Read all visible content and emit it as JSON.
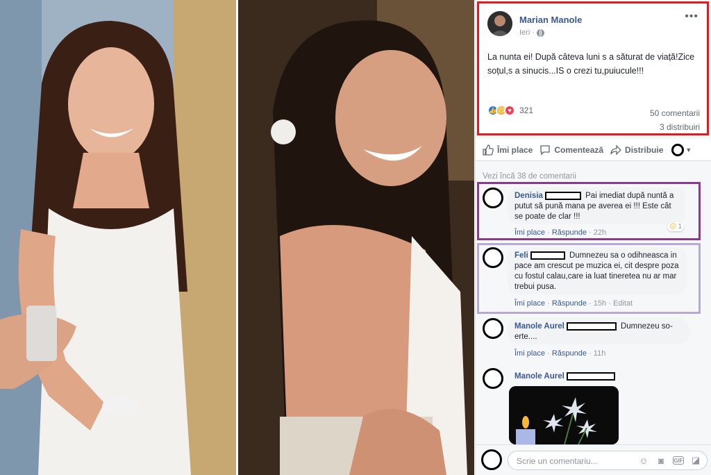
{
  "post": {
    "author": "Marian Manole",
    "time": "Ieri",
    "text": "La nunta ei! După câteva luni s a săturat de viață!Zice soțul,s a sinucis...IS o crezi tu,puiucule!!!",
    "reaction_count": "321",
    "comments_count": "50 comentarii",
    "shares_count": "3 distribuiri"
  },
  "actions": {
    "like": "Îmi place",
    "comment": "Comentează",
    "share": "Distribuie"
  },
  "view_more": "Vezi încă 38 de comentarii",
  "comments": [
    {
      "name": "Denisia",
      "text": "Pai imediat după nuntă a putut să pună mana pe averea ei !!! Este cât se poate de clar !!!",
      "like": "Îmi place",
      "reply": "Răspunde",
      "time": "22h",
      "reaction_count": "1"
    },
    {
      "name": "Feli",
      "text": "Dumnezeu sa o odihneasca in pace am crescut pe muzica ei, cit despre poza cu fostul calau,care ia luat tineretea nu ar mar trebui pusa.",
      "like": "Îmi place",
      "reply": "Răspunde",
      "time": "15h",
      "edited": "Editat"
    },
    {
      "name": "Manole Aurel",
      "text": "Dumnezeu so-erte....",
      "like": "Îmi place",
      "reply": "Răspunde",
      "time": "11h"
    },
    {
      "name": "Manole Aurel"
    }
  ],
  "compose": {
    "placeholder": "Scrie un comentariu..."
  },
  "colors": {
    "fb_link": "#385898",
    "highlight_red": "#e11b22",
    "highlight_purple": "#8a3a8a",
    "highlight_lavender": "#b7a9d3"
  }
}
